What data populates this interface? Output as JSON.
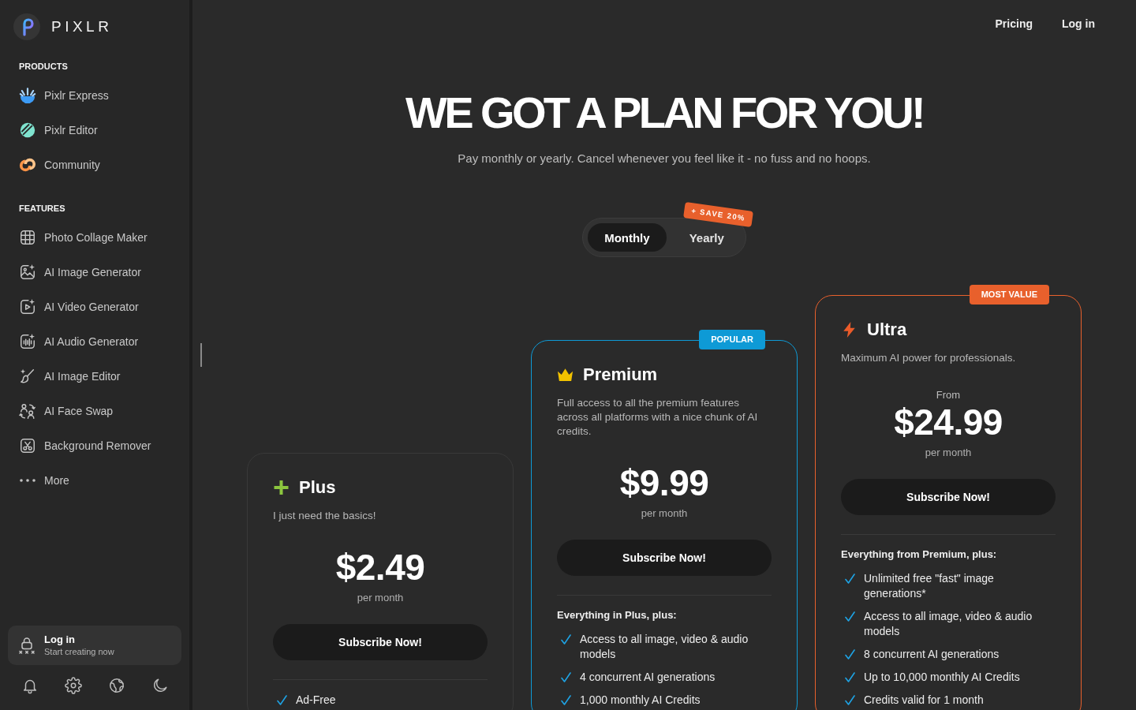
{
  "sidebar": {
    "brand": "PIXLR",
    "sections": [
      {
        "heading": "PRODUCTS",
        "items": [
          {
            "label": "Pixlr Express"
          },
          {
            "label": "Pixlr Editor"
          },
          {
            "label": "Community"
          }
        ]
      },
      {
        "heading": "FEATURES",
        "items": [
          {
            "label": "Photo Collage Maker"
          },
          {
            "label": "AI Image Generator"
          },
          {
            "label": "AI Video Generator"
          },
          {
            "label": "AI Audio Generator"
          },
          {
            "label": "AI Image Editor"
          },
          {
            "label": "AI Face Swap"
          },
          {
            "label": "Background Remover"
          },
          {
            "label": "More"
          }
        ]
      }
    ],
    "login": {
      "title": "Log in",
      "subtitle": "Start creating now"
    }
  },
  "top_nav": [
    {
      "label": "Pricing"
    },
    {
      "label": "Log in"
    }
  ],
  "hero": {
    "title": "WE GOT A PLAN FOR YOU!",
    "subtitle": "Pay monthly or yearly. Cancel whenever you feel like it - no fuss and no hoops."
  },
  "billing_toggle": {
    "options": [
      {
        "label": "Monthly",
        "selected": true
      },
      {
        "label": "Yearly",
        "selected": false
      }
    ],
    "save_badge": "+ SAVE 20%"
  },
  "plans": [
    {
      "name": "Plus",
      "color": "#8cc63e",
      "description": "I just need the basics!",
      "price": "$2.49",
      "period": "per month",
      "button": "Subscribe Now!",
      "features": [
        "Ad-Free"
      ]
    },
    {
      "name": "Premium",
      "color": "#f2c200",
      "badge": {
        "label": "POPULAR",
        "color": "#0e9ad6"
      },
      "description": "Full access to all the premium features across all platforms with a nice chunk of AI credits.",
      "price": "$9.99",
      "period": "per month",
      "button": "Subscribe Now!",
      "features_heading": "Everything in Plus, plus:",
      "features": [
        "Access to all image, video & audio models",
        "4 concurrent AI generations",
        "1,000 monthly AI Credits"
      ]
    },
    {
      "name": "Ultra",
      "color": "#ea5b2a",
      "badge": {
        "label": "MOST VALUE",
        "color": "#e8602c"
      },
      "description": "Maximum AI power for professionals.",
      "price_prefix": "From",
      "price": "$24.99",
      "period": "per month",
      "button": "Subscribe Now!",
      "features_heading": "Everything from Premium, plus:",
      "features": [
        "Unlimited free \"fast\" image generations*",
        "Access to all image, video & audio models",
        "8 concurrent AI generations",
        "Up to 10,000 monthly AI Credits",
        "Credits valid for 1 month"
      ]
    }
  ]
}
